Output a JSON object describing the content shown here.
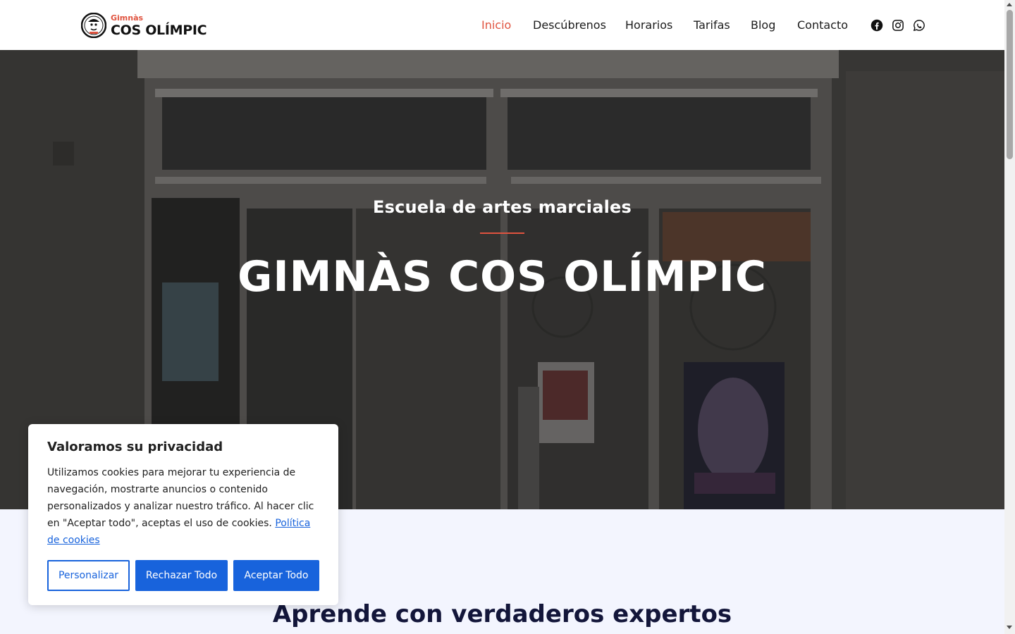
{
  "header": {
    "logo_small": "Gimnàs",
    "logo_big": "COS OLÍMPIC",
    "nav": [
      {
        "label": "Inicio",
        "active": true
      },
      {
        "label": "Descúbrenos"
      },
      {
        "label": "Horarios"
      },
      {
        "label": "Tarifas"
      },
      {
        "label": "Blog"
      },
      {
        "label": "Contacto"
      }
    ],
    "social_icons": [
      "facebook-icon",
      "instagram-icon",
      "whatsapp-icon"
    ],
    "accent_color": "#e0533f"
  },
  "hero": {
    "subtitle": "Escuela de artes marciales",
    "title": "GIMNÀS COS OLÍMPIC"
  },
  "section": {
    "title": "Aprende con verdaderos expertos"
  },
  "cookie_banner": {
    "title": "Valoramos su privacidad",
    "text": "Utilizamos cookies para mejorar tu experiencia de navegación, mostrarte anuncios o contenido personalizados y analizar nuestro tráfico. Al hacer clic en \"Aceptar todo\", aceptas el uso de cookies.",
    "link_label": "Política de cookies",
    "customize_label": "Personalizar",
    "reject_label": "Rechazar Todo",
    "accept_label": "Aceptar Todo",
    "button_color": "#1863dc"
  }
}
